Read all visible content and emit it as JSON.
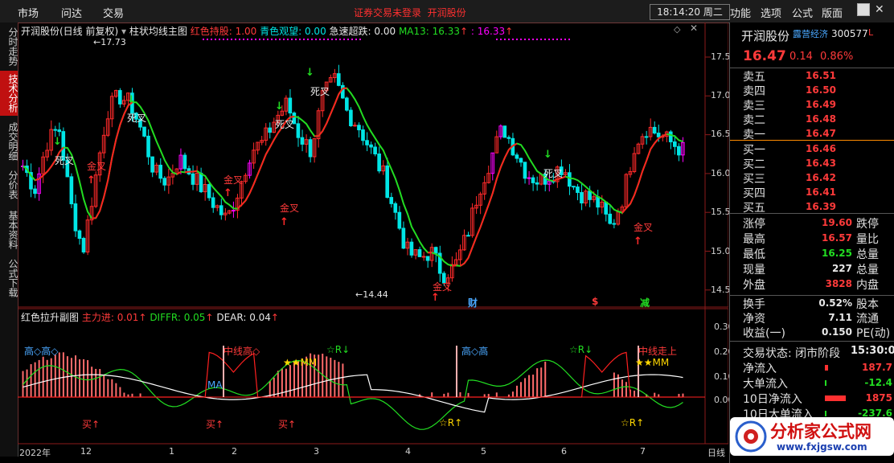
{
  "top_menu": {
    "items": [
      "市场",
      "问达",
      "交易"
    ],
    "promo_left": "证券交易未登录",
    "promo_right": "开润股份",
    "clock": "18:14:20 周二",
    "right_items": [
      "功能",
      "选项",
      "公式",
      "版面"
    ]
  },
  "left_tabs": [
    "分时走势",
    "技术分析",
    "成交明细",
    "分价表",
    "基本资料",
    "公式下载"
  ],
  "main_header": {
    "title": "开润股份(日线 前复权)",
    "indicator": "柱状均线主图",
    "red_label": "红色持股: 1.00",
    "cyan_label": "青色观望: 0.00",
    "white_label": "急速超跌: 0.00",
    "ma_label": "MA13: 16.33",
    "ma_arrow": "↑",
    "ma_value2": ": 16.33",
    "ma_arrow2": "↑"
  },
  "main_axis": {
    "labels": [
      "17.50",
      "17.00",
      "16.50",
      "16.00",
      "15.50",
      "15.00",
      "14.50"
    ],
    "high_label": "17.73",
    "low_label": "14.44"
  },
  "main_annotations": {
    "dead": "死叉",
    "gold": "金叉",
    "cai": "财",
    "s": "$",
    "jian": "减"
  },
  "sub_header": {
    "title": "红色拉升副图",
    "main": "主力进: 0.01",
    "main_arrow": "↑",
    "diffr": "DIFFR: 0.05",
    "diffr_arrow": "↑",
    "dear": "DEAR: 0.04",
    "dear_arrow": "↑"
  },
  "sub_axis": {
    "labels": [
      "0.30",
      "0.20",
      "0.10",
      "0.00"
    ]
  },
  "sub_annotations": {
    "high": "高",
    "mid_up": "中线高",
    "mid_up2": "中线走上",
    "rdown": "☆R↓",
    "mm": "★★MM",
    "ma": "MA",
    "buy": "买↑",
    "rup": "☆R↑"
  },
  "x_axis": {
    "labels": [
      "2022年",
      "12",
      "1",
      "2",
      "3",
      "4",
      "5",
      "6",
      "7"
    ],
    "right_tag": "日线"
  },
  "quote": {
    "name": "开润股份",
    "tag": "露营经济",
    "code": "300577",
    "code_suffix": "L",
    "price": "16.47",
    "change": "0.14",
    "pct": "0.86%",
    "asks": [
      {
        "label": "卖五",
        "price": "16.51"
      },
      {
        "label": "卖四",
        "price": "16.50"
      },
      {
        "label": "卖三",
        "price": "16.49"
      },
      {
        "label": "卖二",
        "price": "16.48"
      },
      {
        "label": "卖一",
        "price": "16.47"
      }
    ],
    "bids": [
      {
        "label": "买一",
        "price": "16.46"
      },
      {
        "label": "买二",
        "price": "16.43"
      },
      {
        "label": "买三",
        "price": "16.42"
      },
      {
        "label": "买四",
        "price": "16.41"
      },
      {
        "label": "买五",
        "price": "16.39"
      }
    ],
    "stats": [
      {
        "l": "涨停",
        "v": "19.60",
        "r": "跌停",
        "c": "red"
      },
      {
        "l": "最高",
        "v": "16.57",
        "r": "量比",
        "c": "red"
      },
      {
        "l": "最低",
        "v": "16.25",
        "r": "总量",
        "c": "grn"
      },
      {
        "l": "现量",
        "v": "227",
        "r": "总量",
        "c": "wht"
      },
      {
        "l": "外盘",
        "v": "3828",
        "r": "内盘",
        "c": "red"
      }
    ],
    "stats2": [
      {
        "l": "换手",
        "v": "0.52%",
        "r": "股本",
        "c": "wht"
      },
      {
        "l": "净资",
        "v": "7.11",
        "r": "流通",
        "c": "wht"
      },
      {
        "l": "收益(一)",
        "v": "0.150",
        "r": "PE(动)",
        "c": "wht"
      }
    ],
    "status_label": "交易状态: 闭市阶段",
    "status_time": "15:30:0",
    "flows": [
      {
        "l": "净流入",
        "v": "187.7",
        "c": "red"
      },
      {
        "l": "大单流入",
        "v": "-12.4",
        "c": "grn"
      },
      {
        "l": "10日净流入",
        "v": "1875",
        "c": "red"
      },
      {
        "l": "10日大单流入",
        "v": "-237.6",
        "c": "grn"
      }
    ]
  },
  "watermark": {
    "text": "分析家公式网",
    "url": "www.fxjgsw.com"
  },
  "colors": {
    "up": "#ff3030",
    "down": "#00e5e5",
    "magenta": "#ff00ff",
    "ma": "#22dd22",
    "red_line": "#ff2020",
    "white_line": "#ffffff"
  }
}
